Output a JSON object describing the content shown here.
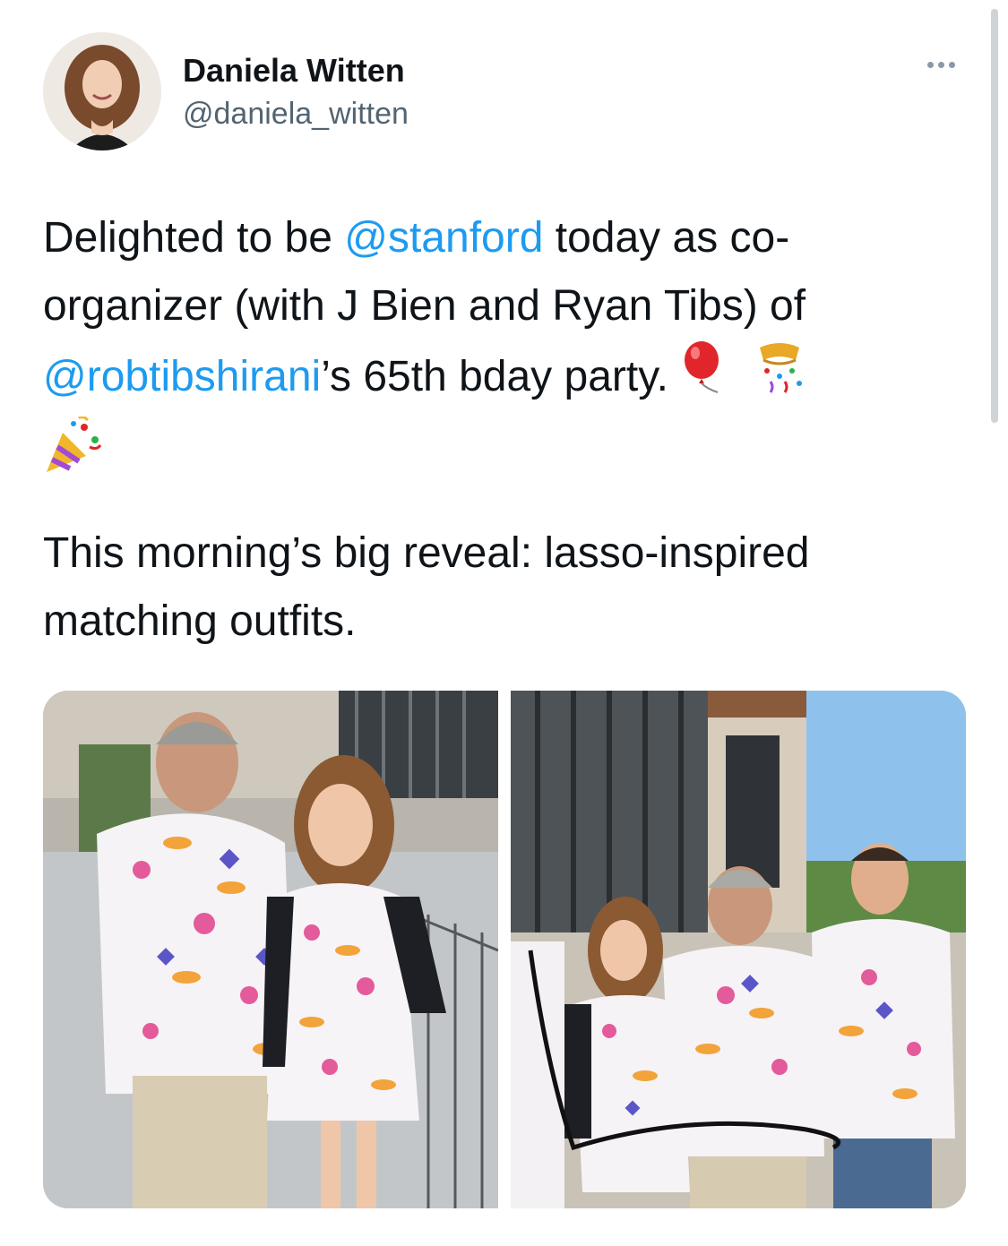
{
  "tweet": {
    "author": {
      "display_name": "Daniela Witten",
      "handle": "@daniela_witten"
    },
    "text": {
      "p1_part1": "Delighted to be ",
      "p1_mention1": "@stanford",
      "p1_part2": " today as co-organizer (with J Bien and Ryan Tibs) of ",
      "p1_mention2": "@robtibshirani",
      "p1_part3": "’s 65th bday party. ",
      "p2": "This morning’s big reveal: lasso-inspired matching outfits."
    },
    "emojis": [
      "balloon-emoji",
      "confetti-ball-emoji",
      "party-popper-emoji"
    ],
    "media_count": 2
  },
  "colors": {
    "mention": "#1d9bf0",
    "text": "#0f1419",
    "secondary": "#536471"
  }
}
